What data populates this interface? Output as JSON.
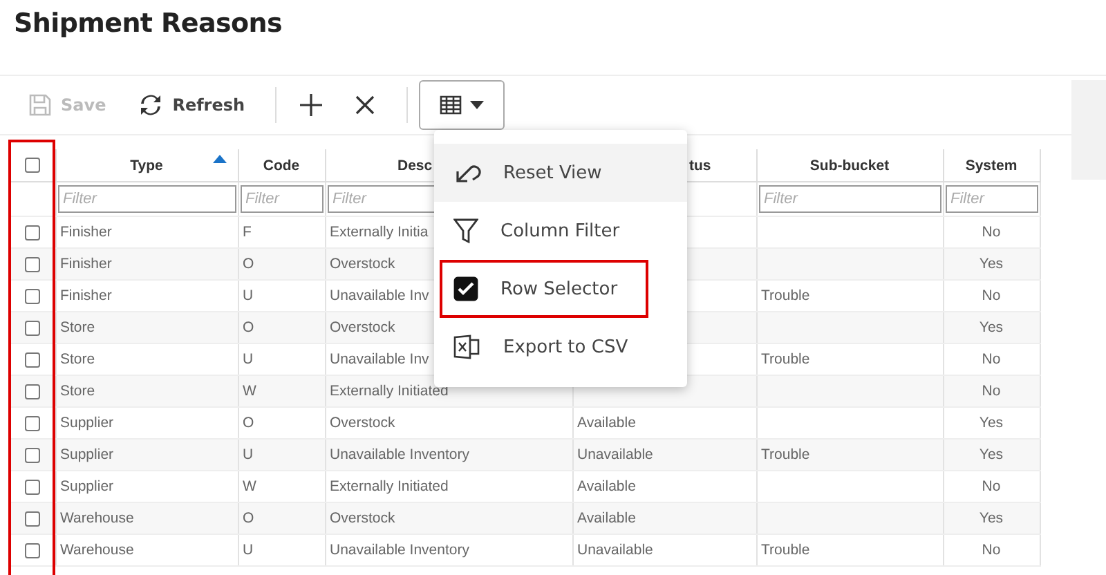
{
  "title": "Shipment Reasons",
  "toolbar": [
    {
      "kind": "save",
      "label": "Save",
      "disabled": true
    },
    {
      "kind": "refresh",
      "label": "Refresh",
      "disabled": false
    },
    {
      "kind": "add",
      "disabled": false
    },
    {
      "kind": "remove",
      "disabled": false
    },
    {
      "kind": "view-menu",
      "disabled": false
    }
  ],
  "table": {
    "select_all": {
      "checked": false
    },
    "columns": [
      {
        "label": "Type",
        "sorted_ascending": true,
        "placeholder": "Filter"
      },
      {
        "label": "Code",
        "sorted_ascending": false,
        "placeholder": "Filter"
      },
      {
        "label": "Desc",
        "placeholder": "Filter"
      },
      {
        "label": "tus"
      },
      {
        "label": "Sub-bucket",
        "sorted_ascending": false,
        "placeholder": "Filter"
      },
      {
        "label": "System",
        "sorted_ascending": false,
        "placeholder": "Filter"
      }
    ],
    "rows": [
      {
        "checked": false,
        "type": "Finisher",
        "code": "F",
        "description": "Externally Initia",
        "system": "No"
      },
      {
        "checked": false,
        "type": "Finisher",
        "code": "O",
        "description": "Overstock",
        "system": "Yes"
      },
      {
        "checked": false,
        "type": "Finisher",
        "code": "U",
        "description": "Unavailable Inv",
        "sub_bucket": "Trouble",
        "system": "No"
      },
      {
        "checked": false,
        "type": "Store",
        "code": "O",
        "description": "Overstock",
        "system": "Yes"
      },
      {
        "checked": false,
        "type": "Store",
        "code": "U",
        "description": "Unavailable Inv",
        "sub_bucket": "Trouble",
        "system": "No"
      },
      {
        "checked": false,
        "type": "Store",
        "code": "W",
        "description": "Externally Initiated",
        "system": "No"
      },
      {
        "checked": false,
        "type": "Supplier",
        "code": "O",
        "description": "Overstock",
        "status": "Available",
        "system": "Yes"
      },
      {
        "checked": false,
        "type": "Supplier",
        "code": "U",
        "description": "Unavailable Inventory",
        "status": "Unavailable",
        "sub_bucket": "Trouble",
        "system": "Yes"
      },
      {
        "checked": false,
        "type": "Supplier",
        "code": "W",
        "description": "Externally Initiated",
        "status": "Available",
        "system": "No"
      },
      {
        "checked": false,
        "type": "Warehouse",
        "code": "O",
        "description": "Overstock",
        "status": "Available",
        "system": "Yes"
      },
      {
        "checked": false,
        "type": "Warehouse",
        "code": "U",
        "description": "Unavailable Inventory",
        "status": "Unavailable",
        "sub_bucket": "Trouble",
        "system": "No"
      }
    ]
  },
  "menu": {
    "items": [
      {
        "kind": "reset",
        "label": "Reset View",
        "highlighted": true,
        "outlined": false
      },
      {
        "kind": "filter",
        "label": "Column Filter",
        "highlighted": false,
        "outlined": false
      },
      {
        "kind": "toggle",
        "label": "Row Selector",
        "checked": true,
        "highlighted": false,
        "outlined": true
      },
      {
        "kind": "export",
        "label": "Export to CSV",
        "highlighted": false,
        "outlined": false
      }
    ]
  },
  "selector_column_outlined": true
}
